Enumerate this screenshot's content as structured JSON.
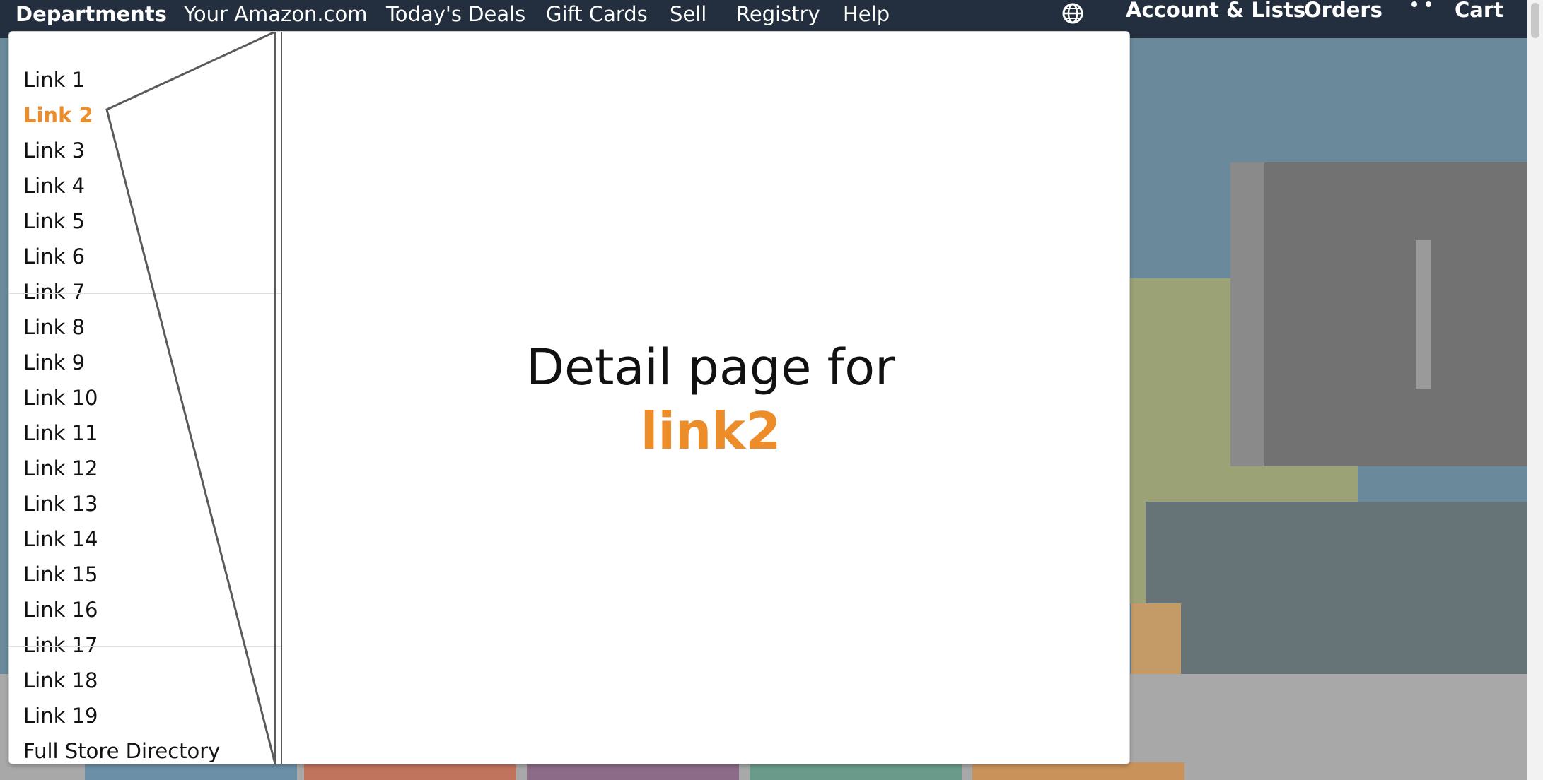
{
  "nav": {
    "departments": "Departments",
    "links": [
      "Your Amazon.com",
      "Today's Deals",
      "Gift Cards",
      "Sell",
      "Registry",
      "Help"
    ],
    "account": "Account & Lists",
    "orders": "Orders",
    "cart": "Cart"
  },
  "menu": {
    "items": [
      "Link 1",
      "Link 2",
      "Link 3",
      "Link 4",
      "Link 5",
      "Link 6",
      "Link 7",
      "Link 8",
      "Link 9",
      "Link 10",
      "Link 11",
      "Link 12",
      "Link 13",
      "Link 14",
      "Link 15",
      "Link 16",
      "Link 17",
      "Link 18",
      "Link 19",
      "Full Store Directory"
    ],
    "active": "Link 2"
  },
  "detail": {
    "heading": "Detail page for",
    "link": "link2"
  },
  "colors": {
    "nav_bg": "#232f3e",
    "accent": "#ec8d2a"
  }
}
